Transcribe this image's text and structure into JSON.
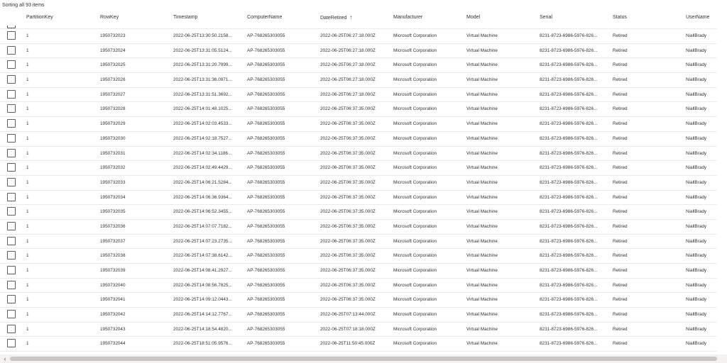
{
  "status": "Sorting all 93 items",
  "columns": {
    "partitionkey": "PartitionKey",
    "rowkey": "RowKey",
    "timestamp": "Timestamp",
    "computername": "ComputerName",
    "dateretired": "DateRetired",
    "manufacturer": "Manufacturer",
    "model": "Model",
    "serial": "Serial",
    "status": "Status",
    "username": "UserName",
    "sort_glyph": "↑"
  },
  "scrollbar": {
    "left_glyph": "‹"
  },
  "rows": [
    {
      "pk": "1",
      "rk": "1950732023",
      "ts": "2022-06-25T13:30:50.2158...",
      "cn": "AP-768265303055",
      "dr": "2022-06-25T06:27:18.000Z",
      "mf": "Microsoft Corporation",
      "md": "Virtual Machine",
      "sr": "8231-8723-6986-5976-826...",
      "st": "Retired",
      "un": "NiallBrady"
    },
    {
      "pk": "1",
      "rk": "1950732024",
      "ts": "2022-06-25T13:31:05.5124...",
      "cn": "AP-768265303055",
      "dr": "2022-06-25T06:27:18.000Z",
      "mf": "Microsoft Corporation",
      "md": "Virtual Machine",
      "sr": "8231-8723-6986-5976-826...",
      "st": "Retired",
      "un": "NiallBrady"
    },
    {
      "pk": "1",
      "rk": "1950732025",
      "ts": "2022-06-25T13:31:20.7999...",
      "cn": "AP-768265303055",
      "dr": "2022-06-25T06:27:18.000Z",
      "mf": "Microsoft Corporation",
      "md": "Virtual Machine",
      "sr": "8231-8723-6986-5976-826...",
      "st": "Retired",
      "un": "NiallBrady"
    },
    {
      "pk": "1",
      "rk": "1950732026",
      "ts": "2022-06-25T13:31:36.0971...",
      "cn": "AP-768265303055",
      "dr": "2022-06-25T06:27:18.000Z",
      "mf": "Microsoft Corporation",
      "md": "Virtual Machine",
      "sr": "8231-8723-6986-5976-826...",
      "st": "Retired",
      "un": "NiallBrady"
    },
    {
      "pk": "1",
      "rk": "1950732027",
      "ts": "2022-06-25T13:31:51.3692...",
      "cn": "AP-768265303055",
      "dr": "2022-06-25T06:27:18.000Z",
      "mf": "Microsoft Corporation",
      "md": "Virtual Machine",
      "sr": "8231-8723-6986-5976-826...",
      "st": "Retired",
      "un": "NiallBrady"
    },
    {
      "pk": "1",
      "rk": "1950732028",
      "ts": "2022-06-25T14:01:48.1025...",
      "cn": "AP-768265303055",
      "dr": "2022-06-25T06:37:35.000Z",
      "mf": "Microsoft Corporation",
      "md": "Virtual Machine",
      "sr": "8231-8723-6986-5976-826...",
      "st": "Retired",
      "un": "NiallBrady"
    },
    {
      "pk": "1",
      "rk": "1950732029",
      "ts": "2022-06-25T14:02:03.4533...",
      "cn": "AP-768265303055",
      "dr": "2022-06-25T06:37:35.000Z",
      "mf": "Microsoft Corporation",
      "md": "Virtual Machine",
      "sr": "8231-8723-6986-5976-826...",
      "st": "Retired",
      "un": "NiallBrady"
    },
    {
      "pk": "1",
      "rk": "1950732030",
      "ts": "2022-06-25T14:02:18.7527...",
      "cn": "AP-768265303055",
      "dr": "2022-06-25T06:37:35.000Z",
      "mf": "Microsoft Corporation",
      "md": "Virtual Machine",
      "sr": "8231-8723-6986-5976-826...",
      "st": "Retired",
      "un": "NiallBrady"
    },
    {
      "pk": "1",
      "rk": "1950732031",
      "ts": "2022-06-25T14:02:34.1186...",
      "cn": "AP-768265303055",
      "dr": "2022-06-25T06:37:35.000Z",
      "mf": "Microsoft Corporation",
      "md": "Virtual Machine",
      "sr": "8231-8723-6986-5976-826...",
      "st": "Retired",
      "un": "NiallBrady"
    },
    {
      "pk": "1",
      "rk": "1950732032",
      "ts": "2022-06-25T14:02:49.4429...",
      "cn": "AP-768265303055",
      "dr": "2022-06-25T06:37:35.000Z",
      "mf": "Microsoft Corporation",
      "md": "Virtual Machine",
      "sr": "8231-8723-6986-5976-826...",
      "st": "Retired",
      "un": "NiallBrady"
    },
    {
      "pk": "1",
      "rk": "1950732033",
      "ts": "2022-06-25T14:06:21.5284...",
      "cn": "AP-768265303055",
      "dr": "2022-06-25T06:37:35.000Z",
      "mf": "Microsoft Corporation",
      "md": "Virtual Machine",
      "sr": "8231-8723-6986-5976-826...",
      "st": "Retired",
      "un": "NiallBrady"
    },
    {
      "pk": "1",
      "rk": "1950732034",
      "ts": "2022-06-25T14:06:36.9364...",
      "cn": "AP-768265303055",
      "dr": "2022-06-25T06:37:35.000Z",
      "mf": "Microsoft Corporation",
      "md": "Virtual Machine",
      "sr": "8231-8723-6986-5976-826...",
      "st": "Retired",
      "un": "NiallBrady"
    },
    {
      "pk": "1",
      "rk": "1950732035",
      "ts": "2022-06-25T14:06:52.3455...",
      "cn": "AP-768265303055",
      "dr": "2022-06-25T06:37:35.000Z",
      "mf": "Microsoft Corporation",
      "md": "Virtual Machine",
      "sr": "8231-8723-6986-5976-826...",
      "st": "Retired",
      "un": "NiallBrady"
    },
    {
      "pk": "1",
      "rk": "1950732036",
      "ts": "2022-06-25T14:07:07.7182...",
      "cn": "AP-768265303055",
      "dr": "2022-06-25T06:37:35.000Z",
      "mf": "Microsoft Corporation",
      "md": "Virtual Machine",
      "sr": "8231-8723-6986-5976-826...",
      "st": "Retired",
      "un": "NiallBrady"
    },
    {
      "pk": "1",
      "rk": "1950732037",
      "ts": "2022-06-25T14:07:23.2735...",
      "cn": "AP-768265303055",
      "dr": "2022-06-25T06:37:35.000Z",
      "mf": "Microsoft Corporation",
      "md": "Virtual Machine",
      "sr": "8231-8723-6986-5976-826...",
      "st": "Retired",
      "un": "NiallBrady"
    },
    {
      "pk": "1",
      "rk": "1950732038",
      "ts": "2022-06-25T14:07:38.6142...",
      "cn": "AP-768265303055",
      "dr": "2022-06-25T06:37:35.000Z",
      "mf": "Microsoft Corporation",
      "md": "Virtual Machine",
      "sr": "8231-8723-6986-5976-826...",
      "st": "Retired",
      "un": "NiallBrady"
    },
    {
      "pk": "1",
      "rk": "1950732039",
      "ts": "2022-06-25T14:08:41.2927...",
      "cn": "AP-768265303055",
      "dr": "2022-06-25T06:37:35.000Z",
      "mf": "Microsoft Corporation",
      "md": "Virtual Machine",
      "sr": "8231-8723-6986-5976-826...",
      "st": "Retired",
      "un": "NiallBrady"
    },
    {
      "pk": "1",
      "rk": "1950732040",
      "ts": "2022-06-25T14:08:56.7825...",
      "cn": "AP-768265303055",
      "dr": "2022-06-25T06:37:35.000Z",
      "mf": "Microsoft Corporation",
      "md": "Virtual Machine",
      "sr": "8231-8723-6986-5976-826...",
      "st": "Retired",
      "un": "NiallBrady"
    },
    {
      "pk": "1",
      "rk": "1950732041",
      "ts": "2022-06-25T14:09:12.0443...",
      "cn": "AP-768265303055",
      "dr": "2022-06-25T06:37:35.000Z",
      "mf": "Microsoft Corporation",
      "md": "Virtual Machine",
      "sr": "8231-8723-6986-5976-826...",
      "st": "Retired",
      "un": "NiallBrady"
    },
    {
      "pk": "1",
      "rk": "1950732042",
      "ts": "2022-06-25T14:14:12.7767...",
      "cn": "AP-768265303055",
      "dr": "2022-06-25T07:13:44.000Z",
      "mf": "Microsoft Corporation",
      "md": "Virtual Machine",
      "sr": "8231-8723-6986-5976-826...",
      "st": "Retired",
      "un": "NiallBrady"
    },
    {
      "pk": "1",
      "rk": "1950732043",
      "ts": "2022-06-25T14:18:54.4820...",
      "cn": "AP-768265303055",
      "dr": "2022-06-25T07:18:18.000Z",
      "mf": "Microsoft Corporation",
      "md": "Virtual Machine",
      "sr": "8231-8723-6986-5976-826...",
      "st": "Retired",
      "un": "NiallBrady"
    },
    {
      "pk": "1",
      "rk": "1950732044",
      "ts": "2022-06-25T18:51:05.9576...",
      "cn": "AP-768265303055",
      "dr": "2022-06-25T11:50:45.000Z",
      "mf": "Microsoft Corporation",
      "md": "Virtual Machine",
      "sr": "8231-8723-6986-5976-826...",
      "st": "Retired",
      "un": "NiallBrady"
    }
  ]
}
